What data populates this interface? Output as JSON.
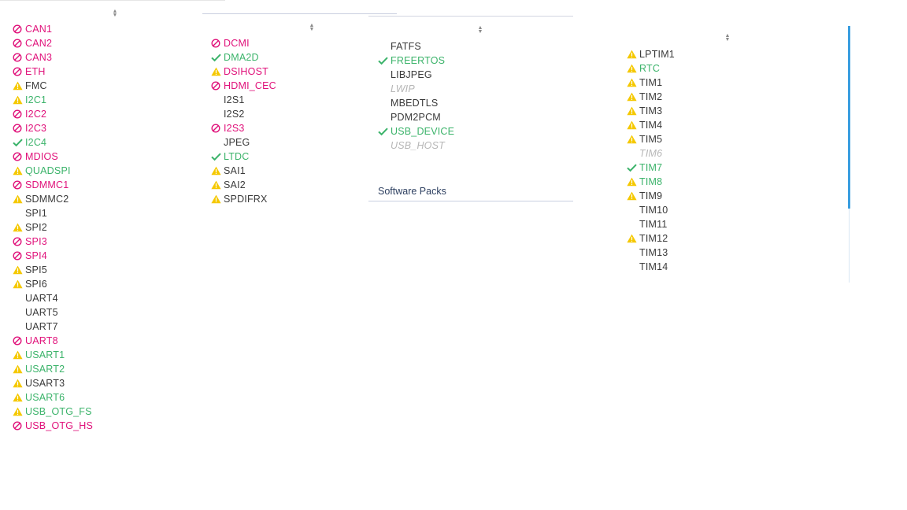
{
  "icons": {
    "disabled": "prohibited-icon",
    "warning": "warning-icon",
    "ok": "checkmark-icon"
  },
  "colors": {
    "red": "#e0117a",
    "green": "#3bb36a",
    "warning": "#f5c800",
    "text": "#3a3a3a",
    "disabled": "#b6b6b6",
    "accent": "#3a9ee0"
  },
  "columns": [
    {
      "items": [
        {
          "label": "CAN1",
          "status": "disabled",
          "color": "red"
        },
        {
          "label": "CAN2",
          "status": "disabled",
          "color": "red"
        },
        {
          "label": "CAN3",
          "status": "disabled",
          "color": "red"
        },
        {
          "label": "ETH",
          "status": "disabled",
          "color": "red"
        },
        {
          "label": "FMC",
          "status": "warning",
          "color": "dark"
        },
        {
          "label": "I2C1",
          "status": "warning",
          "color": "green"
        },
        {
          "label": "I2C2",
          "status": "disabled",
          "color": "red"
        },
        {
          "label": "I2C3",
          "status": "disabled",
          "color": "red"
        },
        {
          "label": "I2C4",
          "status": "ok",
          "color": "green"
        },
        {
          "label": "MDIOS",
          "status": "disabled",
          "color": "red"
        },
        {
          "label": "QUADSPI",
          "status": "warning",
          "color": "green"
        },
        {
          "label": "SDMMC1",
          "status": "disabled",
          "color": "red"
        },
        {
          "label": "SDMMC2",
          "status": "warning",
          "color": "dark"
        },
        {
          "label": "SPI1",
          "status": "none",
          "color": "dark"
        },
        {
          "label": "SPI2",
          "status": "warning",
          "color": "dark"
        },
        {
          "label": "SPI3",
          "status": "disabled",
          "color": "red"
        },
        {
          "label": "SPI4",
          "status": "disabled",
          "color": "red"
        },
        {
          "label": "SPI5",
          "status": "warning",
          "color": "dark"
        },
        {
          "label": "SPI6",
          "status": "warning",
          "color": "dark"
        },
        {
          "label": "UART4",
          "status": "none",
          "color": "dark"
        },
        {
          "label": "UART5",
          "status": "none",
          "color": "dark"
        },
        {
          "label": "UART7",
          "status": "none",
          "color": "dark"
        },
        {
          "label": "UART8",
          "status": "disabled",
          "color": "red"
        },
        {
          "label": "USART1",
          "status": "warning",
          "color": "green"
        },
        {
          "label": "USART2",
          "status": "warning",
          "color": "green"
        },
        {
          "label": "USART3",
          "status": "warning",
          "color": "dark"
        },
        {
          "label": "USART6",
          "status": "warning",
          "color": "green"
        },
        {
          "label": "USB_OTG_FS",
          "status": "warning",
          "color": "green"
        },
        {
          "label": "USB_OTG_HS",
          "status": "disabled",
          "color": "red"
        }
      ]
    },
    {
      "items": [
        {
          "label": "DCMI",
          "status": "disabled",
          "color": "red"
        },
        {
          "label": "DMA2D",
          "status": "ok",
          "color": "green"
        },
        {
          "label": "DSIHOST",
          "status": "warning",
          "color": "red"
        },
        {
          "label": "HDMI_CEC",
          "status": "disabled",
          "color": "red"
        },
        {
          "label": "I2S1",
          "status": "none",
          "color": "dark"
        },
        {
          "label": "I2S2",
          "status": "none",
          "color": "dark"
        },
        {
          "label": "I2S3",
          "status": "disabled",
          "color": "red"
        },
        {
          "label": "JPEG",
          "status": "none",
          "color": "dark"
        },
        {
          "label": "LTDC",
          "status": "ok",
          "color": "green"
        },
        {
          "label": "SAI1",
          "status": "warning",
          "color": "dark"
        },
        {
          "label": "SAI2",
          "status": "warning",
          "color": "dark"
        },
        {
          "label": "SPDIFRX",
          "status": "warning",
          "color": "dark"
        }
      ]
    },
    {
      "items": [
        {
          "label": "FATFS",
          "status": "none",
          "color": "dark"
        },
        {
          "label": "FREERTOS",
          "status": "ok",
          "color": "green"
        },
        {
          "label": "LIBJPEG",
          "status": "none",
          "color": "dark"
        },
        {
          "label": "LWIP",
          "status": "none",
          "color": "disabled"
        },
        {
          "label": "MBEDTLS",
          "status": "none",
          "color": "dark"
        },
        {
          "label": "PDM2PCM",
          "status": "none",
          "color": "dark"
        },
        {
          "label": "USB_DEVICE",
          "status": "ok",
          "color": "green"
        },
        {
          "label": "USB_HOST",
          "status": "none",
          "color": "disabled"
        }
      ],
      "section_title": "Software Packs"
    },
    {
      "items": [
        {
          "label": "LPTIM1",
          "status": "warning",
          "color": "dark"
        },
        {
          "label": "RTC",
          "status": "warning",
          "color": "green"
        },
        {
          "label": "TIM1",
          "status": "warning",
          "color": "dark"
        },
        {
          "label": "TIM2",
          "status": "warning",
          "color": "dark"
        },
        {
          "label": "TIM3",
          "status": "warning",
          "color": "dark"
        },
        {
          "label": "TIM4",
          "status": "warning",
          "color": "dark"
        },
        {
          "label": "TIM5",
          "status": "warning",
          "color": "dark"
        },
        {
          "label": "TIM6",
          "status": "none",
          "color": "disabled"
        },
        {
          "label": "TIM7",
          "status": "ok",
          "color": "green"
        },
        {
          "label": "TIM8",
          "status": "warning",
          "color": "green"
        },
        {
          "label": "TIM9",
          "status": "warning",
          "color": "dark"
        },
        {
          "label": "TIM10",
          "status": "none",
          "color": "dark"
        },
        {
          "label": "TIM11",
          "status": "none",
          "color": "dark"
        },
        {
          "label": "TIM12",
          "status": "warning",
          "color": "dark"
        },
        {
          "label": "TIM13",
          "status": "none",
          "color": "dark"
        },
        {
          "label": "TIM14",
          "status": "none",
          "color": "dark"
        }
      ]
    }
  ]
}
